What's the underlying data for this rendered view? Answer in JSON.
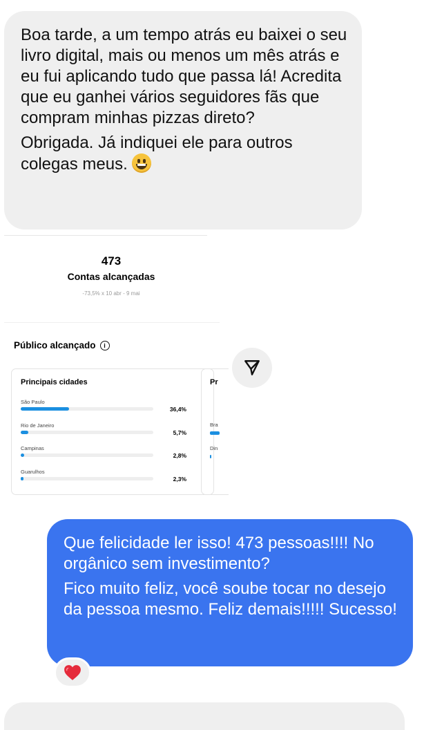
{
  "incoming_message": {
    "paragraph_1": "Boa tarde, a um tempo atrás eu baixei o seu livro digital, mais ou menos um mês atrás e eu fui aplicando tudo que passa lá! Acredita que eu ganhei vários seguidores fãs que compram minhas pizzas direto?",
    "paragraph_2": "Obrigada. Já indiquei ele para outros colegas meus.",
    "emoji_icon": "grinning-face-emoji"
  },
  "shared_screenshot": {
    "reach_count": "473",
    "reach_label": "Contas alcançadas",
    "reach_subtext": "-73,5% x 10 abr - 9 mai",
    "section_title": "Público alcançado",
    "cities_card": {
      "title": "Principais cidades",
      "cities": [
        {
          "name": "São Paulo",
          "percent": "36,4%",
          "value": 36.4
        },
        {
          "name": "Rio de Janeiro",
          "percent": "5,7%",
          "value": 5.7
        },
        {
          "name": "Campinas",
          "percent": "2,8%",
          "value": 2.8
        },
        {
          "name": "Guarulhos",
          "percent": "2,3%",
          "value": 2.3
        }
      ]
    },
    "second_card": {
      "title_fragment": "Pr",
      "rows": [
        "Bra",
        "Din"
      ]
    }
  },
  "share_button_icon": "paper-plane-icon",
  "outgoing_message": {
    "paragraph_1": "Que felicidade ler isso! 473 pessoas!!!! No orgânico sem investimento?",
    "paragraph_2": "Fico muito feliz, você soube tocar no desejo da pessoa mesmo. Feliz demais!!!!! Sucesso!"
  },
  "reaction": {
    "icon": "red-heart-icon"
  },
  "colors": {
    "incoming_bubble": "#efefef",
    "outgoing_bubble": "#3a74ef",
    "bar_accent": "#1b8fe0",
    "heart": "#e52b3b"
  }
}
